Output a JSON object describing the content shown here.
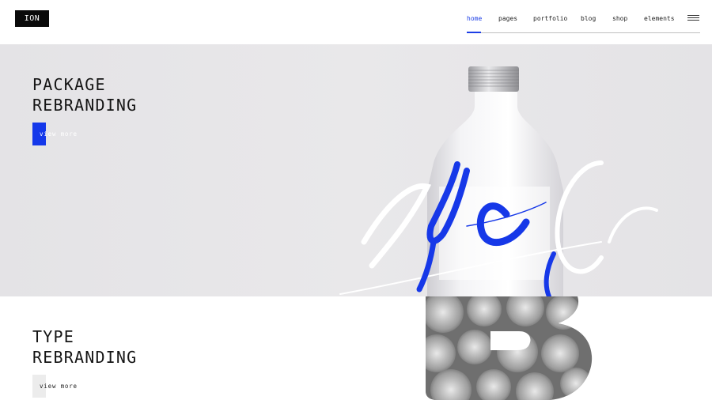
{
  "header": {
    "logo": "ION",
    "nav": [
      {
        "label": "home",
        "active": true
      },
      {
        "label": "pages",
        "active": false
      },
      {
        "label": "portfolio",
        "active": false
      },
      {
        "label": "blog",
        "active": false
      },
      {
        "label": "shop",
        "active": false
      },
      {
        "label": "elements",
        "active": false
      }
    ],
    "menu_icon": "hamburger-icon"
  },
  "slides": [
    {
      "title_line1": "PACKAGE",
      "title_line2": "REBRANDING",
      "button": "view more",
      "button_color": "#1438ea"
    },
    {
      "title_line1": "TYPE",
      "title_line2": "REBRANDING",
      "button": "view more",
      "button_color": "#ececec"
    }
  ],
  "colors": {
    "accent": "#1d3ee6",
    "dark": "#0a0a0a",
    "hero_bg": "#e7e6e8"
  }
}
